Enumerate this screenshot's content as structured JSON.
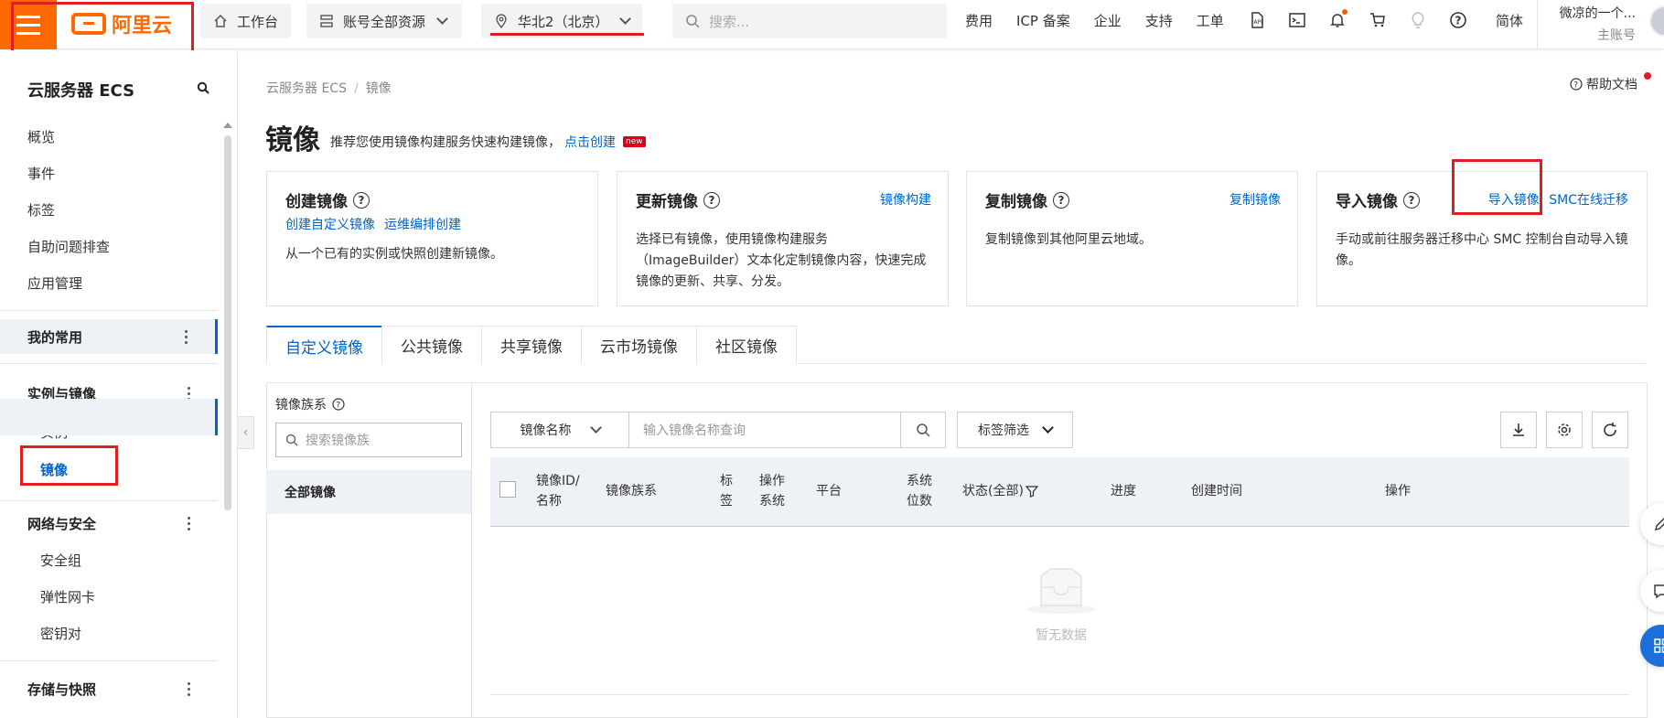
{
  "topbar": {
    "brand": "阿里云",
    "workbench": "工作台",
    "resources": "账号全部资源",
    "region": "华北2（北京）",
    "search_placeholder": "搜索...",
    "links": [
      "费用",
      "ICP 备案",
      "企业",
      "支持",
      "工单"
    ],
    "icons": [
      "api-icon",
      "terminal-icon",
      "bell-icon",
      "cart-icon",
      "lightbulb-icon",
      "help-icon"
    ],
    "lang": "简体",
    "account_name": "微凉的一个...",
    "account_type": "主账号"
  },
  "sidebar": {
    "title": "云服务器 ECS",
    "items": [
      "概览",
      "事件",
      "标签",
      "自助问题排查",
      "应用管理"
    ],
    "group_mine": "我的常用",
    "group_instances": "实例与镜像",
    "instances_items": [
      "实例",
      "镜像"
    ],
    "group_network": "网络与安全",
    "network_items": [
      "安全组",
      "弹性网卡",
      "密钥对"
    ],
    "group_storage": "存储与快照"
  },
  "breadcrumb": {
    "root": "云服务器 ECS",
    "current": "镜像"
  },
  "help": "帮助文档",
  "page": {
    "title": "镜像",
    "desc": "推荐您使用镜像构建服务快速构建镜像，",
    "desc_link": "点击创建",
    "new_badge": "new"
  },
  "cards": {
    "create": {
      "title": "创建镜像",
      "link1": "创建自定义镜像",
      "link2": "运维编排创建",
      "desc": "从一个已有的实例或快照创建新镜像。"
    },
    "update": {
      "title": "更新镜像",
      "link": "镜像构建",
      "desc": "选择已有镜像，使用镜像构建服务（ImageBuilder）文本化定制镜像内容，快速完成镜像的更新、共享、分发。"
    },
    "copy": {
      "title": "复制镜像",
      "link": "复制镜像",
      "desc": "复制镜像到其他阿里云地域。"
    },
    "import": {
      "title": "导入镜像",
      "link1": "导入镜像",
      "link2": "SMC在线迁移",
      "desc": "手动或前往服务器迁移中心 SMC 控制台自动导入镜像。"
    }
  },
  "tabs": [
    "自定义镜像",
    "公共镜像",
    "共享镜像",
    "云市场镜像",
    "社区镜像"
  ],
  "family": {
    "label": "镜像族系",
    "search_placeholder": "搜索镜像族",
    "all": "全部镜像"
  },
  "filter": {
    "field": "镜像名称",
    "placeholder": "输入镜像名称查询",
    "tag_filter": "标签筛选"
  },
  "table": {
    "columns": [
      "镜像ID/名称",
      "镜像族系",
      "标签",
      "操作系统",
      "平台",
      "系统位数",
      "状态(全部)",
      "进度",
      "创建时间",
      "操作"
    ],
    "empty": "暂无数据"
  },
  "colors": {
    "accent": "#ff6a00",
    "link": "#0064c8",
    "highlight": "#e02020"
  }
}
